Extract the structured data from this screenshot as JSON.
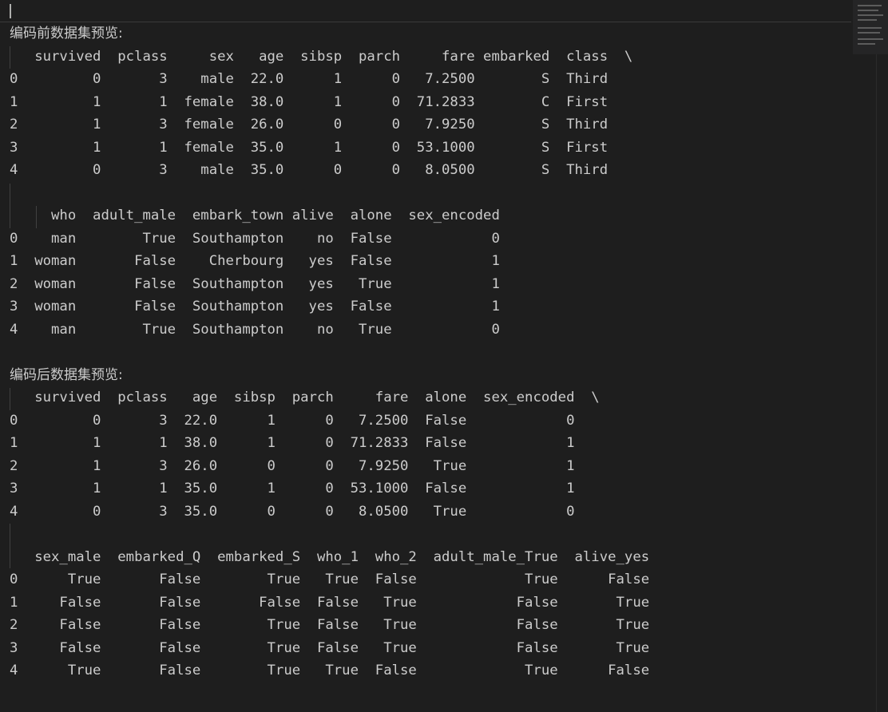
{
  "before": {
    "title": "编码前数据集预览:",
    "header1": "   survived  pclass     sex   age  sibsp  parch     fare embarked  class  \\",
    "rows1": [
      "0         0       3    male  22.0      1      0   7.2500        S  Third",
      "1         1       1  female  38.0      1      0  71.2833        C  First",
      "2         1       3  female  26.0      0      0   7.9250        S  Third",
      "3         1       1  female  35.0      1      0  53.1000        S  First",
      "4         0       3    male  35.0      0      0   8.0500        S  Third"
    ],
    "header2": "     who  adult_male  embark_town alive  alone  sex_encoded",
    "rows2": [
      "0    man        True  Southampton    no  False            0",
      "1  woman       False    Cherbourg   yes  False            1",
      "2  woman       False  Southampton   yes   True            1",
      "3  woman       False  Southampton   yes  False            1",
      "4    man        True  Southampton    no   True            0"
    ]
  },
  "after": {
    "title": "编码后数据集预览:",
    "header1": "   survived  pclass   age  sibsp  parch     fare  alone  sex_encoded  \\",
    "rows1": [
      "0         0       3  22.0      1      0   7.2500  False            0",
      "1         1       1  38.0      1      0  71.2833  False            1",
      "2         1       3  26.0      0      0   7.9250   True            1",
      "3         1       1  35.0      1      0  53.1000  False            1",
      "4         0       3  35.0      0      0   8.0500   True            0"
    ],
    "header2": "   sex_male  embarked_Q  embarked_S  who_1  who_2  adult_male_True  alive_yes",
    "rows2": [
      "0      True       False        True   True  False             True      False",
      "1     False       False       False  False   True            False       True",
      "2     False       False        True  False   True            False       True",
      "3     False       False        True  False   True            False       True",
      "4      True       False        True   True  False             True      False"
    ]
  }
}
